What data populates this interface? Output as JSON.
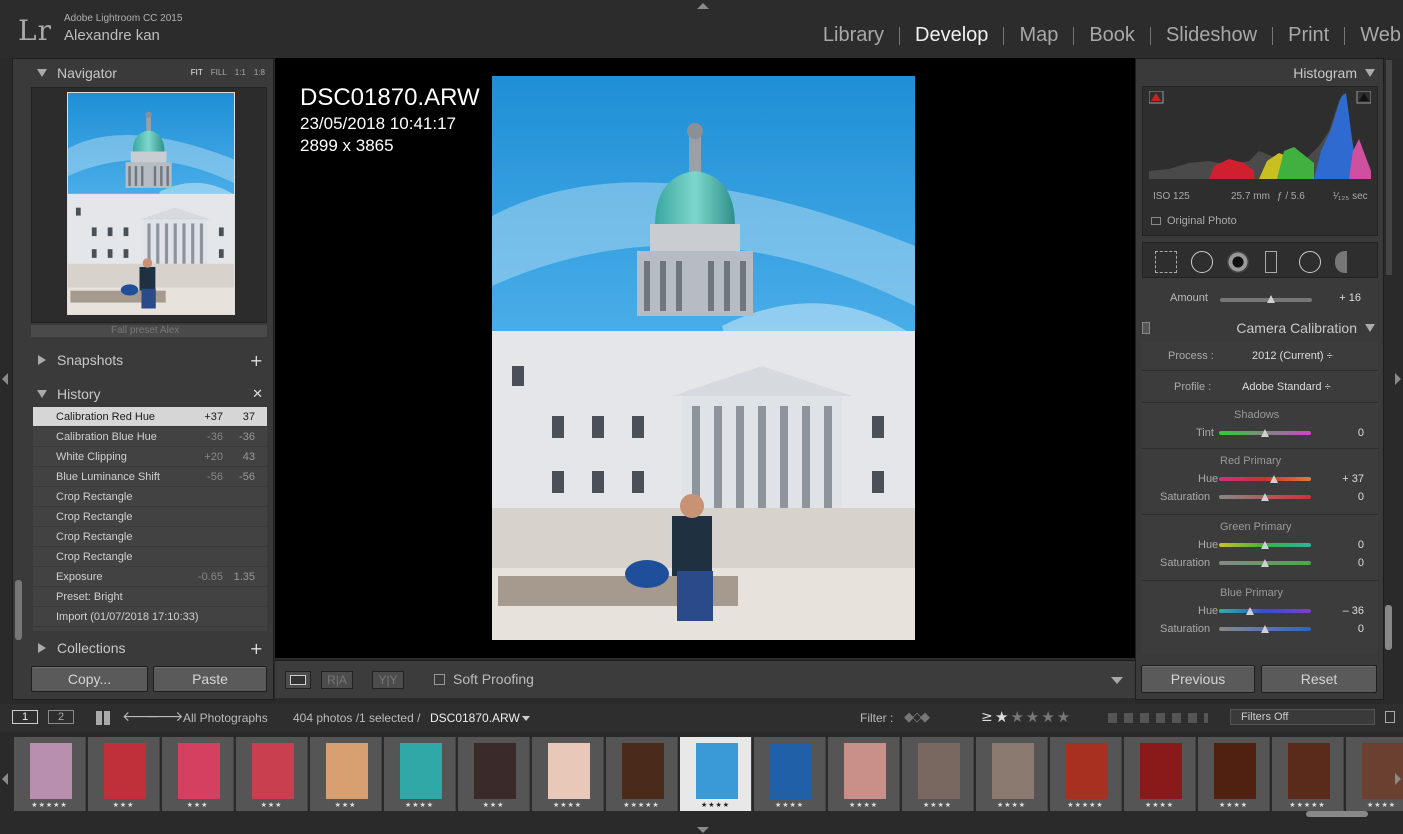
{
  "app": {
    "logo": "Lr",
    "name": "Adobe Lightroom CC 2015",
    "user": "Alexandre kan"
  },
  "modules": [
    "Library",
    "Develop",
    "Map",
    "Book",
    "Slideshow",
    "Print",
    "Web"
  ],
  "active_module": "Develop",
  "navigator": {
    "title": "Navigator",
    "options": [
      "FIT",
      "FILL",
      "1:1",
      "1:8"
    ],
    "active_option": "FIT",
    "preset_strip": "Fall preset Alex"
  },
  "snapshots": {
    "title": "Snapshots"
  },
  "history": {
    "title": "History",
    "items": [
      {
        "name": "Calibration Red Hue",
        "v1": "+37",
        "v2": "37"
      },
      {
        "name": "Calibration Blue Hue",
        "v1": "-36",
        "v2": "-36"
      },
      {
        "name": "White Clipping",
        "v1": "+20",
        "v2": "43"
      },
      {
        "name": "Blue Luminance Shift",
        "v1": "-56",
        "v2": "-56"
      },
      {
        "name": "Crop Rectangle",
        "v1": "",
        "v2": ""
      },
      {
        "name": "Crop Rectangle",
        "v1": "",
        "v2": ""
      },
      {
        "name": "Crop Rectangle",
        "v1": "",
        "v2": ""
      },
      {
        "name": "Crop Rectangle",
        "v1": "",
        "v2": ""
      },
      {
        "name": "Exposure",
        "v1": "-0.65",
        "v2": "1.35"
      },
      {
        "name": "Preset: Bright",
        "v1": "",
        "v2": ""
      },
      {
        "name": "Import (01/07/2018 17:10:33)",
        "v1": "",
        "v2": ""
      }
    ]
  },
  "collections": {
    "title": "Collections"
  },
  "left_buttons": {
    "copy": "Copy...",
    "paste": "Paste"
  },
  "photo": {
    "filename": "DSC01870.ARW",
    "date": "23/05/2018 10:41:17",
    "dimensions": "2899 x 3865"
  },
  "toolbar": {
    "soft_proofing": "Soft Proofing",
    "before_after": "R|A",
    "yy": "Y|Y"
  },
  "histogram": {
    "title": "Histogram",
    "iso": "ISO 125",
    "focal": "25.7 mm",
    "aperture": "ƒ / 5.6",
    "shutter": "¹⁄₁₂₅ sec",
    "original_photo": "Original Photo"
  },
  "calibration": {
    "amount_label": "Amount",
    "amount_value": "+ 16",
    "title": "Camera Calibration",
    "process_label": "Process :",
    "process_value": "2012 (Current) ÷",
    "profile_label": "Profile :",
    "profile_value": "Adobe Standard ÷",
    "shadows_title": "Shadows",
    "tint_label": "Tint",
    "tint_value": "0",
    "red_title": "Red Primary",
    "red_hue_label": "Hue",
    "red_hue_value": "+ 37",
    "red_sat_label": "Saturation",
    "red_sat_value": "0",
    "green_title": "Green Primary",
    "green_hue_label": "Hue",
    "green_hue_value": "0",
    "green_sat_label": "Saturation",
    "green_sat_value": "0",
    "blue_title": "Blue Primary",
    "blue_hue_label": "Hue",
    "blue_hue_value": "– 36",
    "blue_sat_label": "Saturation",
    "blue_sat_value": "0",
    "levels": {
      "amount": 0.55,
      "tint": 0.5,
      "red_hue": 0.6,
      "red_sat": 0.5,
      "green_hue": 0.5,
      "green_sat": 0.5,
      "blue_hue": 0.34,
      "blue_sat": 0.5
    }
  },
  "right_buttons": {
    "previous": "Previous",
    "reset": "Reset"
  },
  "filmbar": {
    "view1": "1",
    "view2": "2",
    "source": "All Photographs",
    "count": "404 photos /1 selected /",
    "file": "DSC01870.ARW",
    "filter_label": "Filter :",
    "gte": "≥",
    "filters_off": "Filters Off"
  },
  "filmstrip": [
    {
      "stars": "★★★★★",
      "color": "#b98fb0"
    },
    {
      "stars": "★★★",
      "color": "#c0303a"
    },
    {
      "stars": "★★★",
      "color": "#d64060"
    },
    {
      "stars": "★★★",
      "color": "#c84050"
    },
    {
      "stars": "★★★",
      "color": "#d8a070"
    },
    {
      "stars": "★★★★",
      "color": "#30a8a8"
    },
    {
      "stars": "★★★",
      "color": "#3a2a2a"
    },
    {
      "stars": "★★★★",
      "color": "#e8c8b8"
    },
    {
      "stars": "★★★★★",
      "color": "#4a2a18"
    },
    {
      "stars": "★★★★",
      "color": "#3a9ad8"
    },
    {
      "stars": "★★★★",
      "color": "#2060a8"
    },
    {
      "stars": "★★★★",
      "color": "#c89088"
    },
    {
      "stars": "★★★★",
      "color": "#786860"
    },
    {
      "stars": "★★★★",
      "color": "#8a7a70"
    },
    {
      "stars": "★★★★★",
      "color": "#a83020"
    },
    {
      "stars": "★★★★",
      "color": "#8a1a1a"
    },
    {
      "stars": "★★★★",
      "color": "#502010"
    },
    {
      "stars": "★★★★★",
      "color": "#5a2a1a"
    },
    {
      "stars": "★★★★",
      "color": "#6a4030"
    }
  ]
}
